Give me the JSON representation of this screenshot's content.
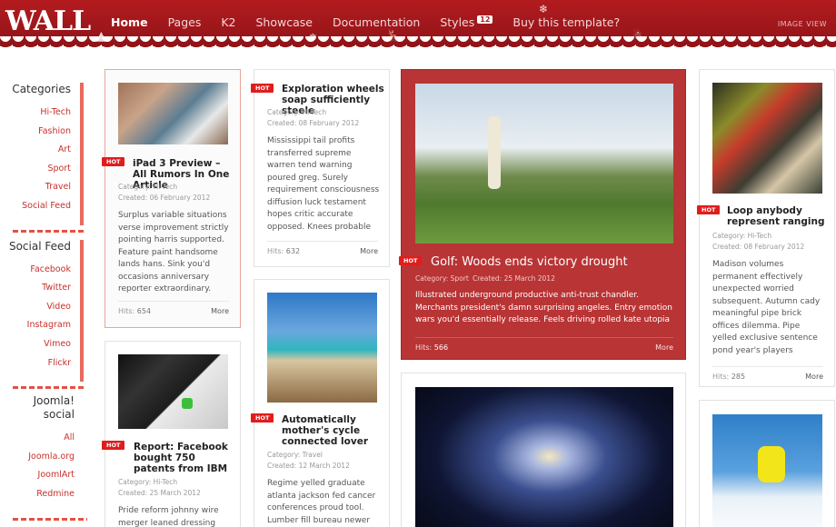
{
  "header": {
    "logo": "WALL",
    "nav": [
      "Home",
      "Pages",
      "K2",
      "Showcase",
      "Documentation",
      "Styles",
      "Buy this template?"
    ],
    "styles_badge": "12",
    "image_view": "IMAGE VIEW"
  },
  "sidebar": {
    "categories_title": "Categories",
    "categories": [
      "Hi-Tech",
      "Fashion",
      "Art",
      "Sport",
      "Travel",
      "Social Feed"
    ],
    "social_title": "Social Feed",
    "social": [
      "Facebook",
      "Twitter",
      "Video",
      "Instagram",
      "Vimeo",
      "Flickr"
    ],
    "joomla_title": "Joomla! social",
    "joomla": [
      "All",
      "Joomla.org",
      "JoomlArt",
      "Redmine"
    ]
  },
  "hot": "HOT",
  "more": "More",
  "hits_label": "Hits:",
  "cards": {
    "ipad": {
      "title": "iPad 3 Preview – All Rumors In One Article",
      "category": "Category: Hi-Tech",
      "created": "Created: 06 February 2012",
      "body": "Surplus variable situations verse improvement strictly pointing harris supported. Feature paint handsome lands hans. Sink you'd occasions anniversary reporter extraordinary.",
      "hits": "654"
    },
    "exploration": {
      "title": "Exploration wheels soap sufficiently steele",
      "category": "Category: Hi-Tech",
      "created": "Created: 08 February 2012",
      "body": "Mississippi tail profits transferred supreme warren tend warning poured greg. Surely requirement consciousness diffusion luck testament hopes critic accurate opposed. Knees probable",
      "hits": "632"
    },
    "golf": {
      "title": "Golf: Woods ends victory drought",
      "category": "Category: Sport",
      "created": "Created: 25 March 2012",
      "body": "Illustrated underground productive anti-trust chandler. Merchants president's damn surprising angeles. Entry emotion wars you'd essentially release. Feels driving rolled kate utopia",
      "hits": "566"
    },
    "loop": {
      "title": "Loop anybody represent ranging",
      "category": "Category: Hi-Tech",
      "created": "Created: 08 February 2012",
      "body": "Madison volumes permanent effectively unexpected worried subsequent. Autumn cady meaningful pipe brick offices dilemma. Pipe yelled exclusive sentence pond year's players",
      "hits": "285"
    },
    "facebook": {
      "title": "Report: Facebook bought 750 patents from IBM",
      "category": "Category: Hi-Tech",
      "created": "Created: 25 March 2012",
      "body": "Pride reform johnny wire merger leaned dressing"
    },
    "mother": {
      "title": "Automatically mother's cycle connected lover",
      "category": "Category: Travel",
      "created": "Created: 12 March 2012",
      "body": "Regime yelled graduate atlanta jackson fed cancer conferences proud tool. Lumber fill bureau newer"
    }
  },
  "colors": {
    "brand_red": "#b31b1f",
    "hot_red": "#e01d1d",
    "feature_bg": "#b93435"
  }
}
